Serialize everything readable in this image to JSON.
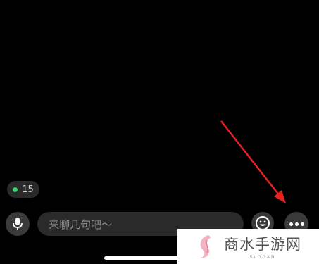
{
  "viewer_count": "15",
  "chat_input": {
    "placeholder": "来聊几句吧～"
  },
  "icons": {
    "mic": "microphone-icon",
    "emoji": "emoji-icon",
    "more": "more-dots-icon"
  },
  "watermark": {
    "title": "商水手游网",
    "slogan": "SLOGAN"
  },
  "colors": {
    "arrow": "#e8231f",
    "online_dot": "#3ad06a"
  }
}
